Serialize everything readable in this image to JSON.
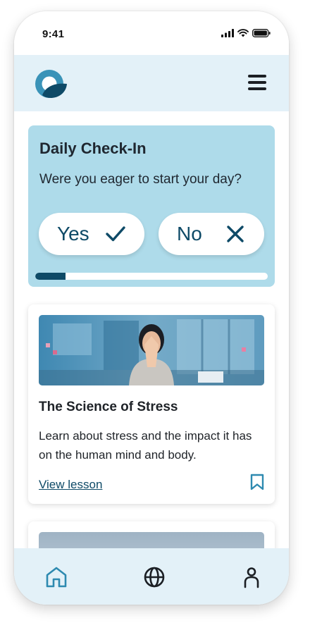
{
  "status_bar": {
    "time": "9:41"
  },
  "header": {
    "logo": "brand-logo",
    "menu_icon": "hamburger-menu-icon"
  },
  "checkin": {
    "title": "Daily Check-In",
    "question": "Were you eager to start your day?",
    "yes_label": "Yes",
    "no_label": "No",
    "progress_fraction": 0.13
  },
  "lesson": {
    "title": "The Science of Stress",
    "description": "Learn about stress and the impact it has on the human mind and body.",
    "link_label": "View lesson",
    "image": "stressed-woman-at-desk-photo"
  },
  "bottom_nav": {
    "items": [
      {
        "icon": "home-icon",
        "active": true
      },
      {
        "icon": "globe-icon",
        "active": false
      },
      {
        "icon": "profile-icon",
        "active": false
      }
    ]
  },
  "colors": {
    "header_bg": "#e3f1f8",
    "card_bg": "#aedbea",
    "primary": "#0e4a67",
    "active_nav": "#2e8ab0"
  }
}
